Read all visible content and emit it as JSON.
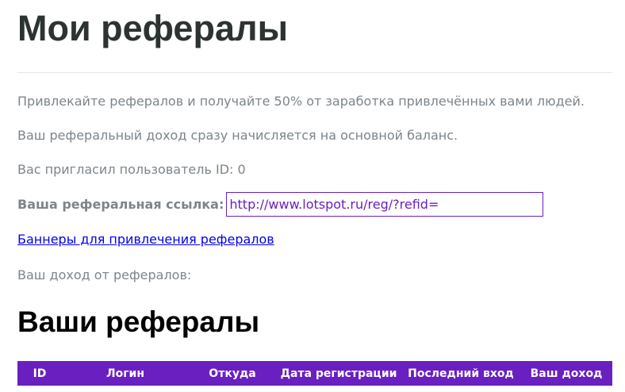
{
  "page": {
    "title": "Мои рефералы",
    "intro": "Привлекайте рефералов и получайте 50% от заработка привлечённых вами людей.",
    "balance_note": "Ваш реферальный доход сразу начисляется на основной баланс.",
    "invited_by": "Вас пригласил пользователь ID: 0",
    "ref_link": {
      "label": "Ваша реферальная ссылка:",
      "value": "http://www.lotspot.ru/reg/?refid="
    },
    "banners_link": "Баннеры для привлечения рефералов",
    "income_label": "Ваш доход от рефералов:"
  },
  "referrals": {
    "title": "Ваши рефералы",
    "columns": [
      "ID",
      "Логин",
      "Откуда",
      "Дата регистрации",
      "Последний вход",
      "Ваш доход"
    ]
  },
  "colors": {
    "accent": "#6a1fc0",
    "heading": "#2c3330",
    "text": "#7c858b",
    "link": "#0000ee"
  }
}
